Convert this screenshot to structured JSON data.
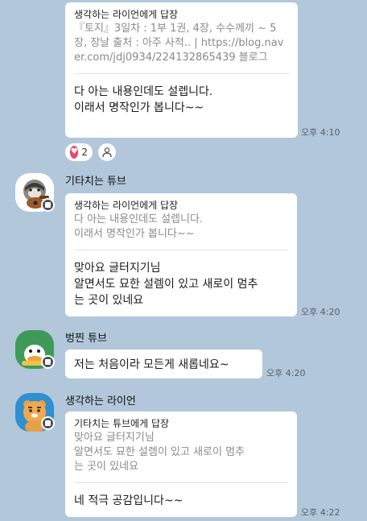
{
  "messages": [
    {
      "reply_to": "생각하는 라이언에게 답장",
      "quoted": "『토지』3일차 : 1부 1권, 4장, 수수께끼 ~ 5장, 장날 출처 : 아주 사적.. | https://blog.naver.com/jdj0934/224132865439 블로그",
      "text": "다 아는 내용인데도 설렙니다.\n이래서 명작인가 봅니다~~",
      "time": "오후 4:10",
      "reaction_count": "2"
    },
    {
      "sender": "기타치는 튜브",
      "reply_to": "생각하는 라이언에게 답장",
      "quoted": "다 아는 내용인데도 설렙니다.\n이래서 명작인가 봅니다~~",
      "text": "맞아요 글터지기님\n알면서도 묘한 설렘이 있고 새로이 멈추\n는 곳이 있네요",
      "time": "오후 4:20"
    },
    {
      "sender": "벙찐 튜브",
      "text": "저는 처음이라 모든게 새롭네요~",
      "time": "오후 4:20"
    },
    {
      "sender": "생각하는 라이언",
      "reply_to": "기타치는 튜브에게 답장",
      "quoted": "맞아요 글터지기님\n알면서도 묘한 설렘이 있고 새로이 멈추\n는 곳이 있네요",
      "text": "네 적극 공감입니다~~",
      "time": "오후 4:22"
    }
  ],
  "colors": {
    "background": "#b2c7da",
    "bubble": "#ffffff",
    "heart": "#f0456d"
  },
  "icons": {
    "reaction": "heart-icon",
    "add_reaction": "person-icon",
    "badge": "kakao-badge-icon"
  }
}
